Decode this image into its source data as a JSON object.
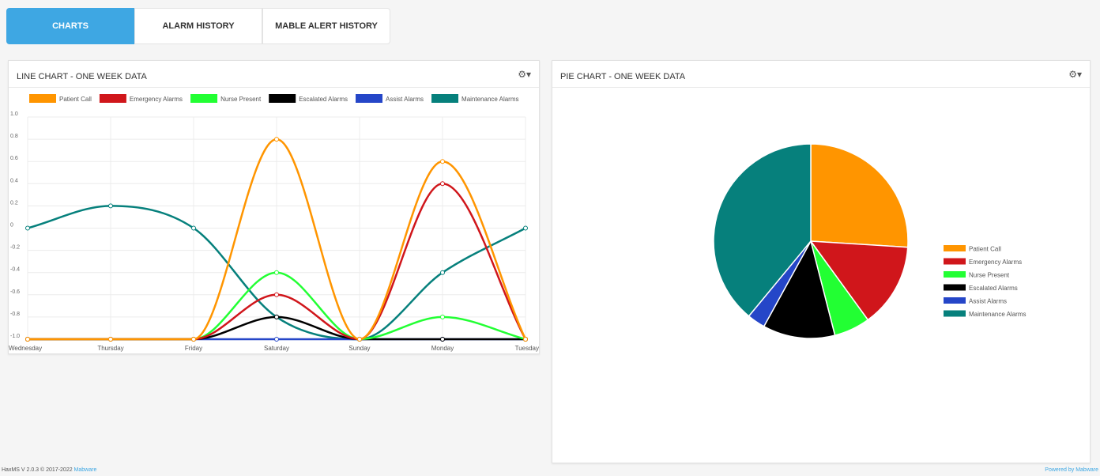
{
  "tabs": [
    {
      "label": "CHARTS",
      "active": true
    },
    {
      "label": "ALARM HISTORY",
      "active": false
    },
    {
      "label": "MABLE ALERT HISTORY",
      "active": false
    }
  ],
  "line_panel": {
    "title": "LINE CHART - ONE WEEK DATA",
    "tool_icon": "settings-dropdown-icon"
  },
  "pie_panel": {
    "title": "PIE CHART - ONE WEEK DATA",
    "tool_icon": "settings-dropdown-icon"
  },
  "footer": {
    "left": "HaxMS V 2.0.3 © 2017-2022 ",
    "left_link": "Mabware",
    "right": "Powered by Mabware"
  },
  "colors": {
    "patient_call": "#ff9500",
    "emergency": "#d0161b",
    "nurse_present": "#22ff33",
    "escalated": "#000000",
    "assist": "#2546c8",
    "maintenance": "#06807c"
  },
  "chart_data": [
    {
      "type": "line",
      "title": "LINE CHART - ONE WEEK DATA",
      "categories": [
        "Wednesday",
        "Thursday",
        "Friday",
        "Saturday",
        "Sunday",
        "Monday",
        "Tuesday"
      ],
      "ylim": [
        -1.0,
        1.0
      ],
      "yticks": [
        1.0,
        0.8,
        0.6,
        0.4,
        0.2,
        0,
        -0.2,
        -0.4,
        -0.6,
        -0.8,
        -1.0
      ],
      "ytick_labels": [
        "1.0",
        "0.8",
        "0.6",
        "0.4",
        "0.2",
        "0",
        "-0.2",
        "-0.4",
        "-0.6",
        "-0.8",
        "-1.0"
      ],
      "grid": true,
      "legend_position": "top",
      "series": [
        {
          "name": "Patient Call",
          "color": "#ff9500",
          "values": [
            -1,
            -1,
            -1,
            0.8,
            -1,
            0.6,
            -1
          ]
        },
        {
          "name": "Emergency Alarms",
          "color": "#d0161b",
          "values": [
            -1,
            -1,
            -1,
            -0.6,
            -1,
            0.4,
            -1
          ]
        },
        {
          "name": "Nurse Present",
          "color": "#22ff33",
          "values": [
            -1,
            -1,
            -1,
            -0.4,
            -1,
            -0.8,
            -1
          ]
        },
        {
          "name": "Escalated Alarms",
          "color": "#000000",
          "values": [
            -1,
            -1,
            -1,
            -0.8,
            -1,
            -1,
            -1
          ]
        },
        {
          "name": "Assist Alarms",
          "color": "#2546c8",
          "values": [
            -1,
            -1,
            -1,
            -1,
            -1,
            -1,
            -1
          ]
        },
        {
          "name": "Maintenance Alarms",
          "color": "#06807c",
          "values": [
            0,
            0.2,
            0,
            -0.8,
            -1,
            -0.4,
            0
          ]
        }
      ]
    },
    {
      "type": "pie",
      "title": "PIE CHART - ONE WEEK DATA",
      "legend_position": "right",
      "slices": [
        {
          "name": "Patient Call",
          "color": "#ff9500",
          "value": 26
        },
        {
          "name": "Emergency Alarms",
          "color": "#d0161b",
          "value": 14
        },
        {
          "name": "Nurse Present",
          "color": "#22ff33",
          "value": 6
        },
        {
          "name": "Escalated Alarms",
          "color": "#000000",
          "value": 12
        },
        {
          "name": "Assist Alarms",
          "color": "#2546c8",
          "value": 3
        },
        {
          "name": "Maintenance Alarms",
          "color": "#06807c",
          "value": 39
        }
      ]
    }
  ]
}
